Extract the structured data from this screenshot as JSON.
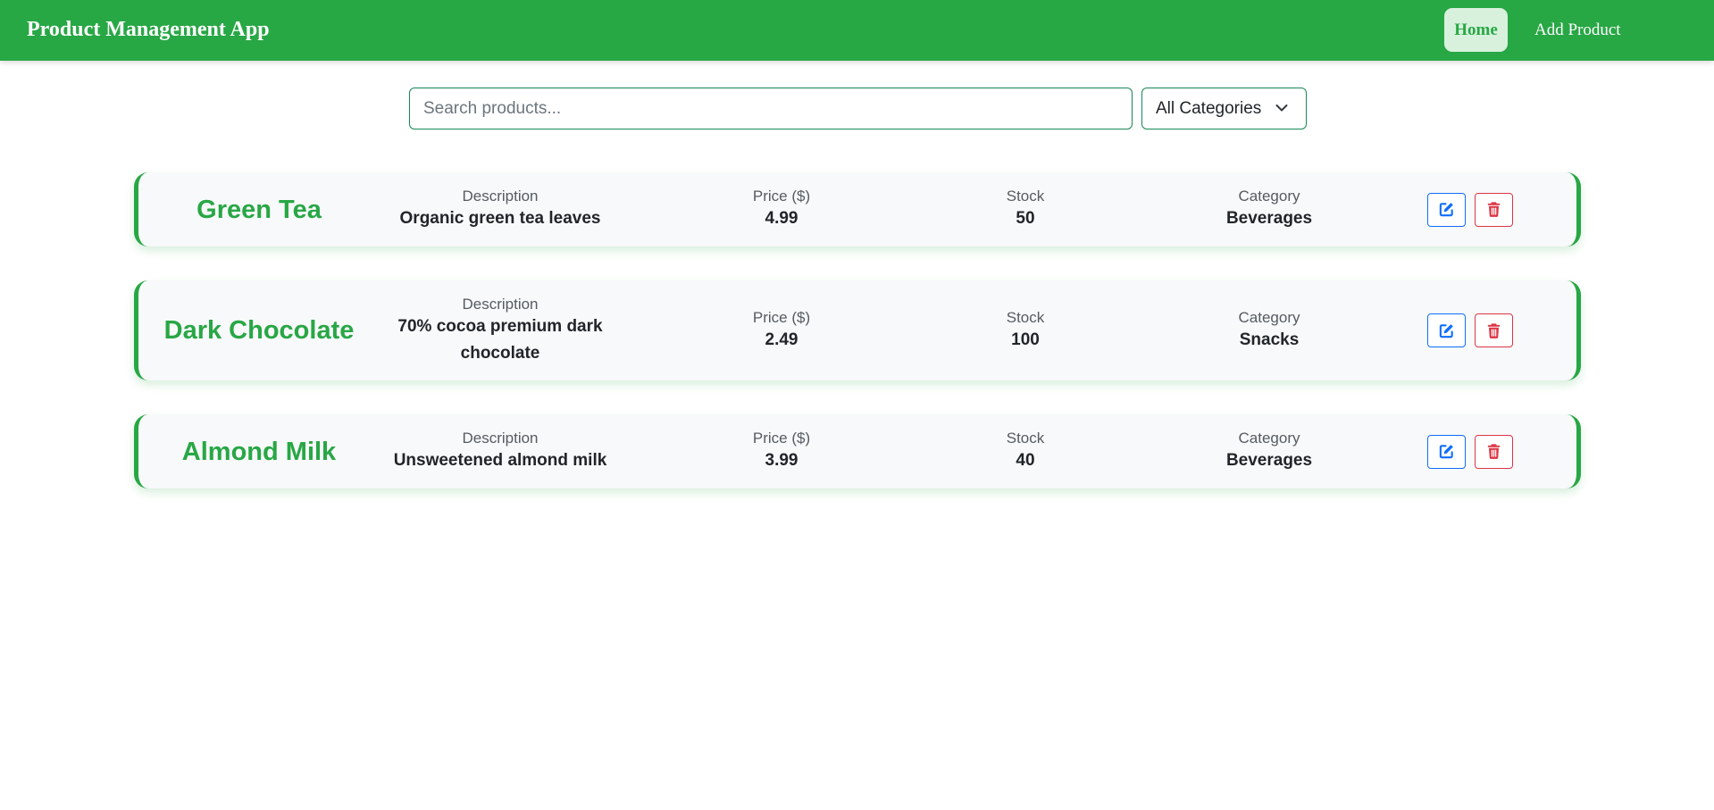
{
  "app": {
    "brand": "Product Management App"
  },
  "nav": {
    "home_label": "Home",
    "add_label": "Add Product",
    "active": "Home"
  },
  "search": {
    "placeholder": "Search products...",
    "value": ""
  },
  "category_filter": {
    "selected": "All Categories"
  },
  "labels": {
    "description": "Description",
    "price": "Price ($)",
    "stock": "Stock",
    "category": "Category"
  },
  "products": [
    {
      "name": "Green Tea",
      "description": "Organic green tea leaves",
      "price": "4.99",
      "stock": "50",
      "category": "Beverages"
    },
    {
      "name": "Dark Chocolate",
      "description": "70% cocoa premium dark chocolate",
      "price": "2.49",
      "stock": "100",
      "category": "Snacks"
    },
    {
      "name": "Almond Milk",
      "description": "Unsweetened almond milk",
      "price": "3.99",
      "stock": "40",
      "category": "Beverages"
    }
  ],
  "icons": {
    "edit": "edit-icon",
    "delete": "trash-icon",
    "dropdown": "chevron-down-icon"
  },
  "colors": {
    "primary_green": "#28a745",
    "edit_blue": "#0d6efd",
    "delete_red": "#dc3545",
    "card_bg": "#f8f9fa"
  }
}
